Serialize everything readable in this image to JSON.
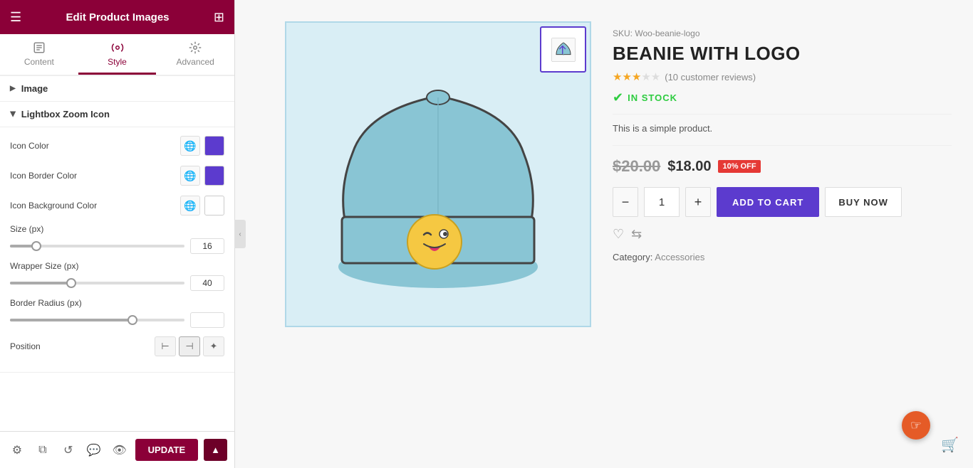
{
  "header": {
    "title": "Edit Product Images",
    "hamburger_label": "☰",
    "grid_label": "⊞"
  },
  "tabs": [
    {
      "label": "Content",
      "id": "content",
      "active": false
    },
    {
      "label": "Style",
      "id": "style",
      "active": true
    },
    {
      "label": "Advanced",
      "id": "advanced",
      "active": false
    }
  ],
  "sections": {
    "image": {
      "label": "Image",
      "collapsed": true
    },
    "lightbox": {
      "label": "Lightbox Zoom Icon",
      "collapsed": false,
      "controls": {
        "icon_color": {
          "label": "Icon Color",
          "value": "#5c3bce"
        },
        "icon_border_color": {
          "label": "Icon Border Color",
          "value": "#5c3bce"
        },
        "icon_bg_color": {
          "label": "Icon Background Color",
          "value": "#ffffff"
        },
        "size": {
          "label": "Size (px)",
          "value": "16",
          "slider_pct": 15
        },
        "wrapper_size": {
          "label": "Wrapper Size (px)",
          "value": "40",
          "slider_pct": 35
        },
        "border_radius": {
          "label": "Border Radius (px)",
          "value": "",
          "slider_pct": 70
        },
        "position": {
          "label": "Position"
        }
      }
    }
  },
  "footer": {
    "update_label": "UPDATE",
    "arrow_label": "▲"
  },
  "product": {
    "sku_label": "SKU:",
    "sku": "Woo-beanie-logo",
    "title": "BEANIE WITH LOGO",
    "stars": 3,
    "reviews": "(10 customer reviews)",
    "stock": "IN STOCK",
    "simple_text": "This is a simple product.",
    "old_price": "$20.00",
    "new_price": "$18.00",
    "discount": "10% OFF",
    "qty": "1",
    "add_to_cart": "ADD TO CART",
    "buy_now": "BUY NOW",
    "category_label": "Category:",
    "category": "Accessories"
  }
}
